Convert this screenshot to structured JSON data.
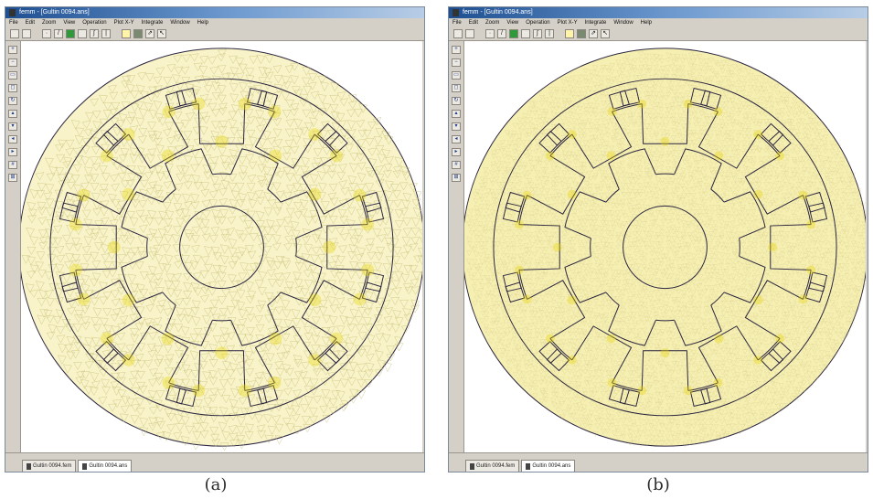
{
  "windows": [
    {
      "id": "a",
      "title": "femm - [Gultin 0094.ans]",
      "menu": [
        "File",
        "Edit",
        "Zoom",
        "View",
        "Operation",
        "Plot X-Y",
        "Integrate",
        "Window",
        "Help"
      ],
      "tabs": [
        "Gultin 0094.fem",
        "Gultin 0094.ans"
      ],
      "mesh_density": "coarse",
      "fill_color": "#f8f3c8"
    },
    {
      "id": "b",
      "title": "femm - [Gultin 0094.ans]",
      "menu": [
        "File",
        "Edit",
        "Zoom",
        "View",
        "Operation",
        "Plot X-Y",
        "Integrate",
        "Window",
        "Help"
      ],
      "tabs": [
        "Gultin 0094.fem",
        "Gultin 0094.ans"
      ],
      "mesh_density": "fine",
      "fill_color": "#f6efb2"
    }
  ],
  "captions": {
    "a": "(a)",
    "b": "(b)"
  },
  "colors": {
    "mesh_line": "#c9c07a",
    "geometry": "#2a2540",
    "highlight": "#e8d800"
  }
}
